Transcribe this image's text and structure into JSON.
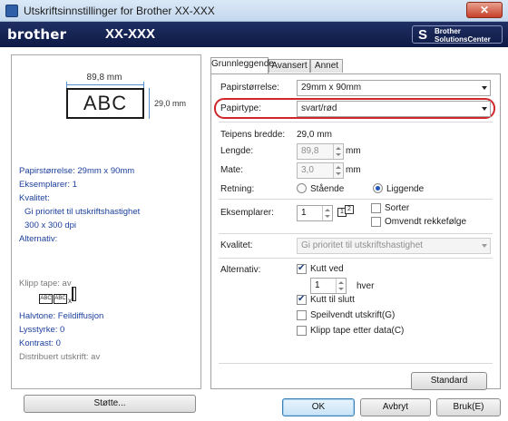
{
  "window": {
    "title": "Utskriftsinnstillinger for Brother XX-XXX",
    "close_glyph": "✕"
  },
  "brand": {
    "logo": "brother",
    "model": "XX-XXX",
    "solutions_line1": "Brother",
    "solutions_line2": "SolutionsCenter",
    "swirl": "S"
  },
  "preview": {
    "width_label": "89,8 mm",
    "height_label": "29,0 mm",
    "sample_text": "ABC"
  },
  "summary": {
    "paper_size": "Papirstørrelse: 29mm x 90mm",
    "copies": "Eksemplarer: 1",
    "quality_head": "Kvalitet:",
    "quality_value": "Gi prioritet til utskriftshastighet",
    "resolution": "300 x 300 dpi",
    "option_head": "Alternativ:",
    "alt_chip": "ABC",
    "alt_x": "x",
    "cut_tape": "Klipp tape: av",
    "halftone": "Halvtone: Feildiffusjon",
    "brightness": "Lysstyrke: 0",
    "contrast": "Kontrast: 0",
    "distributed": "Distribuert utskrift: av"
  },
  "support_button": "Støtte...",
  "tabs": [
    {
      "label": "Grunnleggende"
    },
    {
      "label": "Avansert"
    },
    {
      "label": "Annet"
    }
  ],
  "basic": {
    "paper_size_label": "Papirstørrelse:",
    "paper_size_value": "29mm x 90mm",
    "paper_type_label": "Papirtype:",
    "paper_type_value": "svart/rød",
    "tape_width_label": "Teipens bredde:",
    "tape_width_value": "29,0 mm",
    "length_label": "Lengde:",
    "length_value": "89,8",
    "length_unit": "mm",
    "feed_label": "Mate:",
    "feed_value": "3,0",
    "feed_unit": "mm",
    "orientation_label": "Retning:",
    "portrait": "Stående",
    "landscape": "Liggende",
    "copies_label": "Eksemplarer:",
    "copies_value": "1",
    "collate_1": "1",
    "collate_2": "2",
    "sort_label": "Sorter",
    "reverse_label": "Omvendt rekkefølge",
    "quality_label": "Kvalitet:",
    "quality_value": "Gi prioritet til utskriftshastighet",
    "option_label": "Alternativ:",
    "cut_every_label": "Kutt ved",
    "cut_every_value": "1",
    "cut_every_unit": "hver",
    "cut_at_end_label": "Kutt til slutt",
    "mirror_label": "Speilvendt utskrift(G)",
    "cut_after_data_label": "Klipp tape etter data(C)",
    "default_button": "Standard"
  },
  "footer": {
    "ok": "OK",
    "cancel": "Avbryt",
    "apply": "Bruk(E)"
  }
}
